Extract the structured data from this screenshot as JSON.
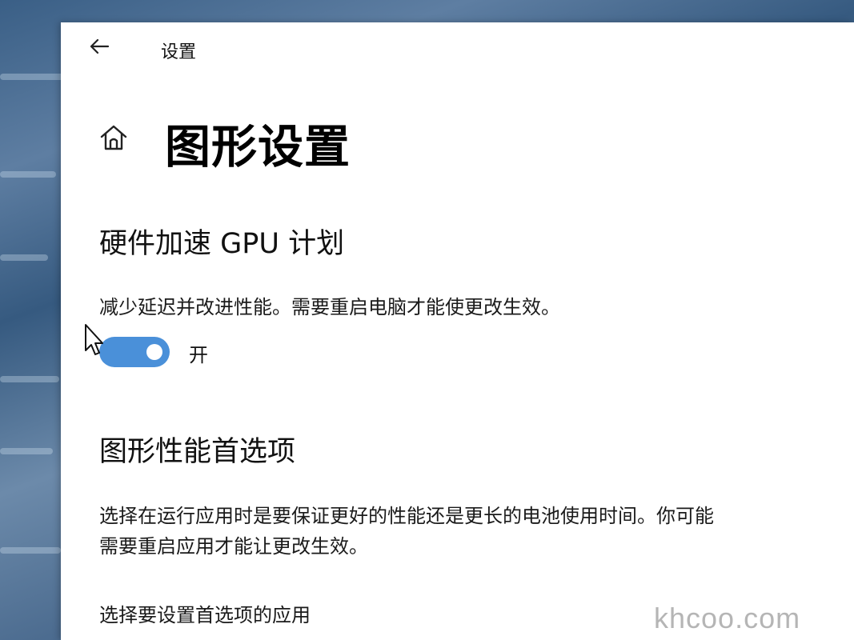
{
  "window": {
    "title": "设置"
  },
  "page": {
    "title": "图形设置"
  },
  "gpu_scheduling": {
    "heading": "硬件加速 GPU 计划",
    "description": "减少延迟并改进性能。需要重启电脑才能使更改生效。",
    "toggle_state": "开",
    "toggle_on": true
  },
  "graphics_preference": {
    "heading": "图形性能首选项",
    "description_line1": "选择在运行应用时是要保证更好的性能还是更长的电池使用时间。你可能",
    "description_line2": "需要重启应用才能让更改生效。",
    "choose_app_label": "选择要设置首选项的应用"
  },
  "watermark": "khcoo.com",
  "icons": {
    "back": "back-arrow-icon",
    "home": "home-icon",
    "cursor": "mouse-pointer-icon"
  },
  "colors": {
    "accent": "#4a90d9",
    "window_bg": "#ffffff"
  }
}
